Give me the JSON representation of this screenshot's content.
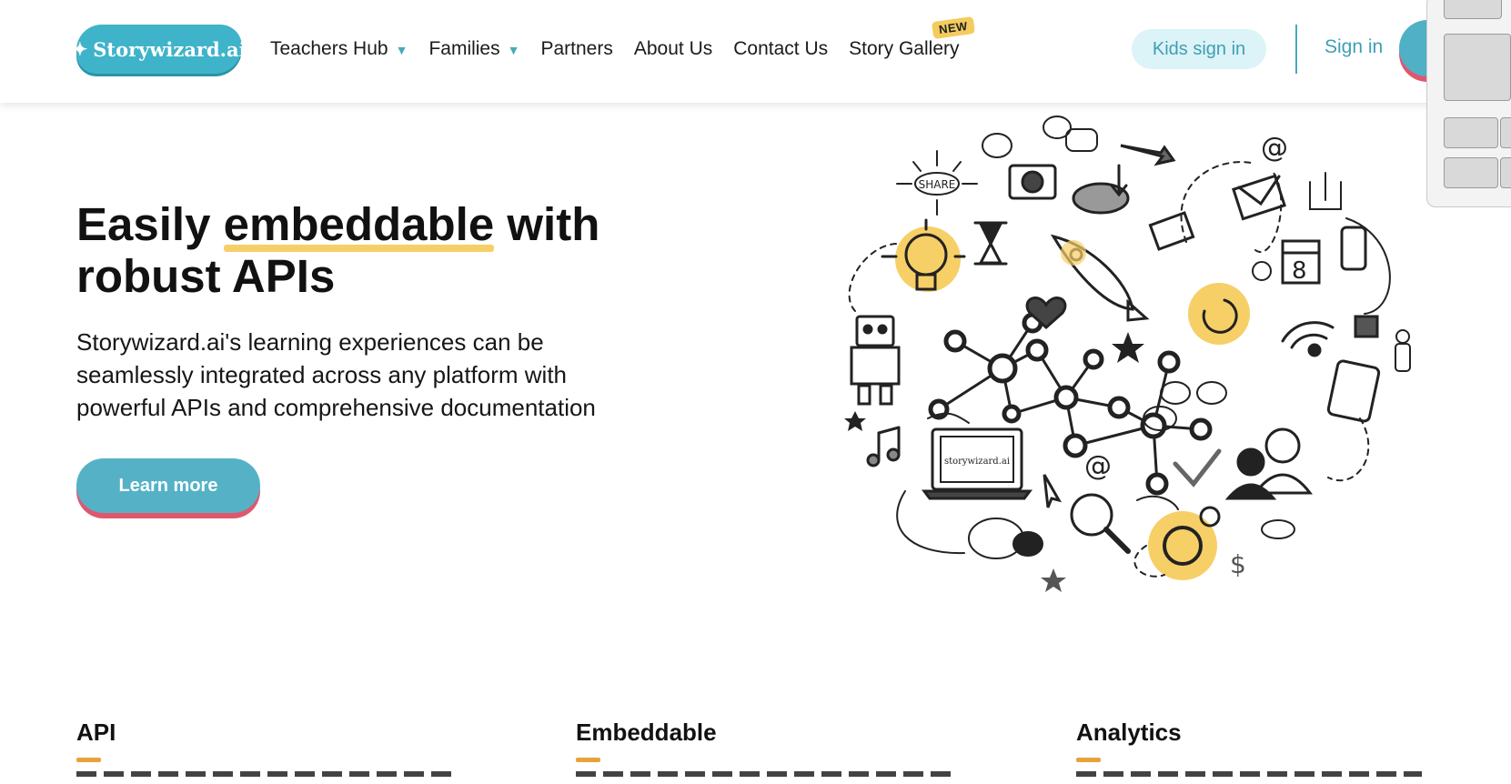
{
  "header": {
    "logo_text": "Storywizard.ai",
    "nav": [
      {
        "label": "Teachers Hub",
        "has_dropdown": true
      },
      {
        "label": "Families",
        "has_dropdown": true
      },
      {
        "label": "Partners",
        "has_dropdown": false
      },
      {
        "label": "About Us",
        "has_dropdown": false
      },
      {
        "label": "Contact Us",
        "has_dropdown": false
      },
      {
        "label": "Story Gallery",
        "has_dropdown": false,
        "badge": "NEW"
      }
    ],
    "kids_sign_in": "Kids sign in",
    "sign_in": "Sign in"
  },
  "hero": {
    "title_pre": "Easily ",
    "title_highlight": "embeddable",
    "title_post": " with robust APIs",
    "description": "Storywizard.ai's learning experiences can be seamlessly integrated across any platform with powerful APIs and comprehensive documentation",
    "cta_label": "Learn more",
    "illustration_laptop_text": "storywizard.ai",
    "illustration_share_text": "SHARE"
  },
  "features": [
    {
      "title": "API"
    },
    {
      "title": "Embeddable"
    },
    {
      "title": "Analytics"
    }
  ],
  "colors": {
    "brand_teal": "#3fb3c9",
    "highlight_yellow": "#f6cf67",
    "accent_pink": "#e0576d",
    "feature_bar_orange": "#e8a23a"
  }
}
